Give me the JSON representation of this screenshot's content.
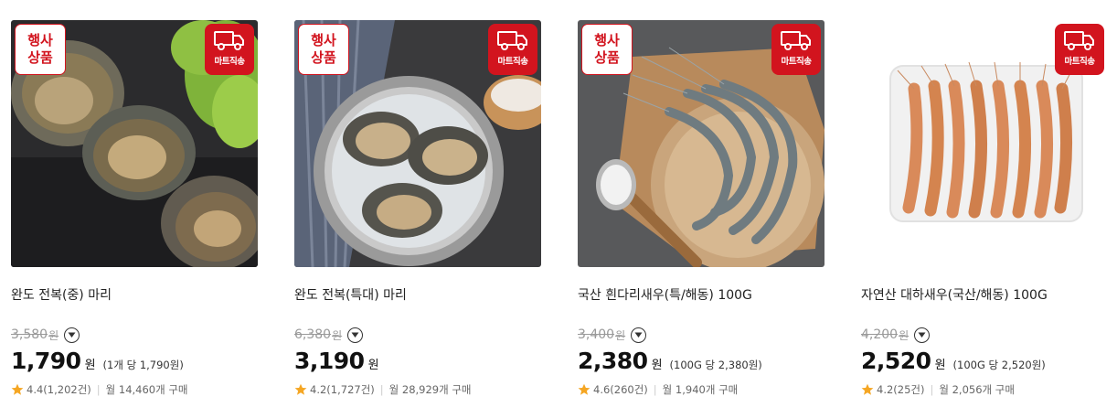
{
  "badges": {
    "event_line1": "행사",
    "event_line2": "상품",
    "delivery": "마트직송"
  },
  "colors": {
    "accent": "#d2141e",
    "star": "#f5a623"
  },
  "products": [
    {
      "title": "완도 전복(중) 마리",
      "original_price": "3,580",
      "original_unit": "원",
      "price": "1,790",
      "won": "원",
      "unit_price": "(1개 당 1,790원)",
      "rating": "4.4(1,202건)",
      "monthly": "월 14,460개 구매",
      "has_event_badge": true
    },
    {
      "title": "완도 전복(특대) 마리",
      "original_price": "6,380",
      "original_unit": "원",
      "price": "3,190",
      "won": "원",
      "unit_price": "",
      "rating": "4.2(1,727건)",
      "monthly": "월 28,929개 구매",
      "has_event_badge": true
    },
    {
      "title": "국산 흰다리새우(특/해동) 100G",
      "original_price": "3,400",
      "original_unit": "원",
      "price": "2,380",
      "won": "원",
      "unit_price": "(100G 당 2,380원)",
      "rating": "4.6(260건)",
      "monthly": "월 1,940개 구매",
      "has_event_badge": true
    },
    {
      "title": "자연산 대하새우(국산/해동) 100G",
      "original_price": "4,200",
      "original_unit": "원",
      "price": "2,520",
      "won": "원",
      "unit_price": "(100G 당 2,520원)",
      "rating": "4.2(25건)",
      "monthly": "월 2,056개 구매",
      "has_event_badge": false
    }
  ]
}
